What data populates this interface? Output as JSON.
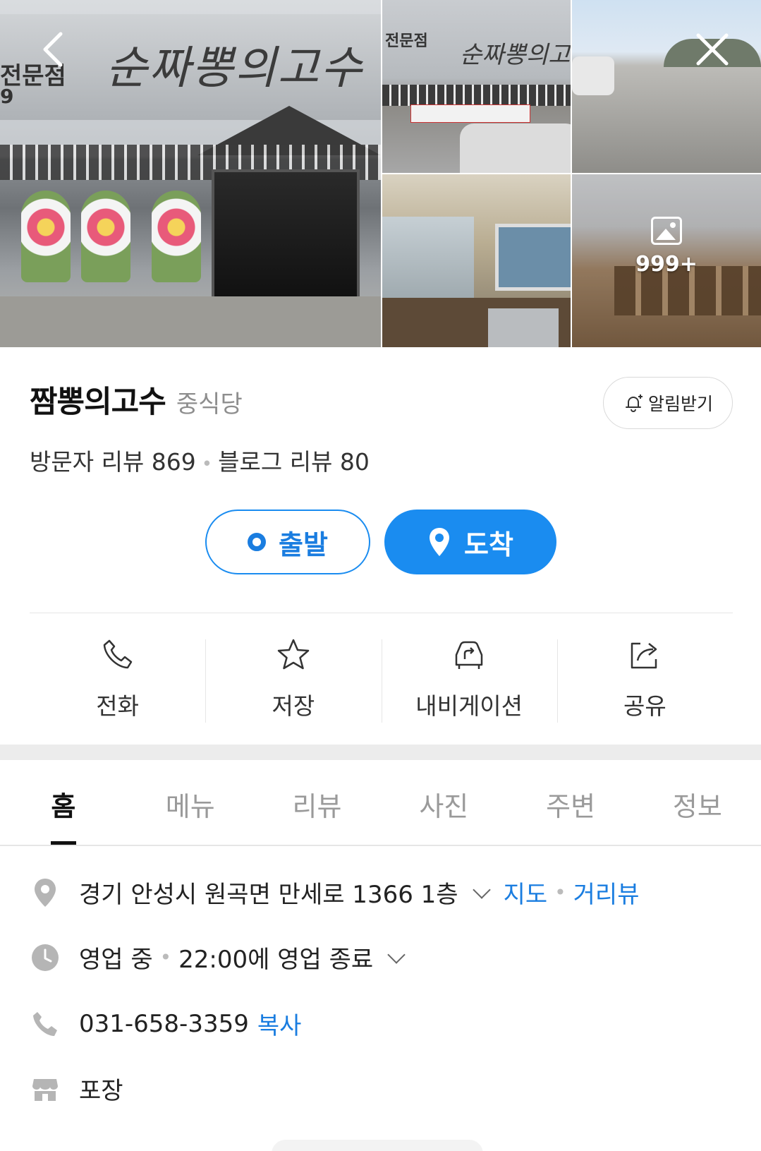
{
  "gallery": {
    "photo_count": "999+",
    "main_sign_text": "순짜뽕의고수",
    "main_sign_left": "전문점",
    "main_sign_left2": "9",
    "thumb_sign_text": "순짜뽕의고수",
    "thumb_sign_left": "전문점"
  },
  "place": {
    "name": "짬뽕의고수",
    "category": "중식당",
    "alert_label": "알림받기",
    "visitor_reviews": "방문자 리뷰 869",
    "blog_reviews": "블로그 리뷰 80",
    "review_sep": "•"
  },
  "route": {
    "depart_label": "출발",
    "arrive_label": "도착"
  },
  "actions": {
    "call": "전화",
    "save": "저장",
    "navigation": "내비게이션",
    "share": "공유"
  },
  "tabs": [
    "홈",
    "메뉴",
    "리뷰",
    "사진",
    "주변",
    "정보"
  ],
  "info": {
    "address": "경기 안성시 원곡면 만세로 1366 1층",
    "map_link": "지도",
    "streetview_link": "거리뷰",
    "sep": "•",
    "status": "영업 중",
    "close_time": "22:00에 영업 종료",
    "phone": "031-658-3359",
    "copy_link": "복사",
    "takeout": "포장"
  },
  "colors": {
    "accent": "#1a8cf0",
    "icon_gray": "#b5b5b5"
  }
}
